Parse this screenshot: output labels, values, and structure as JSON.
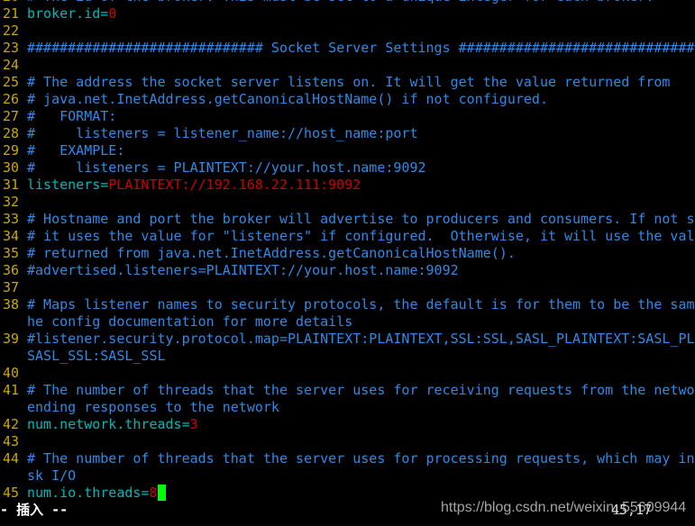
{
  "editor": {
    "rows": [
      {
        "num": "20",
        "segs": [
          {
            "t": "# The id of the broker. This must be set to a unique integer for each broker.",
            "c": "comment"
          }
        ]
      },
      {
        "num": "21",
        "segs": [
          {
            "t": "broker.id=",
            "c": "key"
          },
          {
            "t": "0",
            "c": "val"
          }
        ]
      },
      {
        "num": "22",
        "segs": []
      },
      {
        "num": "23",
        "segs": [
          {
            "t": "############################# Socket Server Settings #############################",
            "c": "comment"
          }
        ]
      },
      {
        "num": "24",
        "segs": []
      },
      {
        "num": "25",
        "segs": [
          {
            "t": "# The address the socket server listens on. It will get the value returned from",
            "c": "comment"
          }
        ]
      },
      {
        "num": "26",
        "segs": [
          {
            "t": "# java.net.InetAddress.getCanonicalHostName() if not configured.",
            "c": "comment"
          }
        ]
      },
      {
        "num": "27",
        "segs": [
          {
            "t": "#   FORMAT:",
            "c": "comment"
          }
        ]
      },
      {
        "num": "28",
        "segs": [
          {
            "t": "#     listeners = listener_name://host_name:port",
            "c": "comment"
          }
        ]
      },
      {
        "num": "29",
        "segs": [
          {
            "t": "#   EXAMPLE:",
            "c": "comment"
          }
        ]
      },
      {
        "num": "30",
        "segs": [
          {
            "t": "#     listeners = PLAINTEXT://your.host.name:9092",
            "c": "comment"
          }
        ]
      },
      {
        "num": "31",
        "segs": [
          {
            "t": "listeners=",
            "c": "key"
          },
          {
            "t": "PLAINTEXT://192.168.22.111:9092",
            "c": "val"
          }
        ]
      },
      {
        "num": "32",
        "segs": []
      },
      {
        "num": "33",
        "segs": [
          {
            "t": "# Hostname and port the broker will advertise to producers and consumers. If not se",
            "c": "comment"
          }
        ]
      },
      {
        "num": "34",
        "segs": [
          {
            "t": "# it uses the value for \"listeners\" if configured.  Otherwise, it will use the valu",
            "c": "comment"
          }
        ]
      },
      {
        "num": "35",
        "segs": [
          {
            "t": "# returned from java.net.InetAddress.getCanonicalHostName().",
            "c": "comment"
          }
        ]
      },
      {
        "num": "36",
        "segs": [
          {
            "t": "#advertised.listeners=PLAINTEXT://your.host.name:9092",
            "c": "comment"
          }
        ]
      },
      {
        "num": "37",
        "segs": []
      },
      {
        "num": "38",
        "segs": [
          {
            "t": "# Maps listener names to security protocols, the default is for them to be the same",
            "c": "comment"
          }
        ]
      },
      {
        "num": "",
        "segs": [
          {
            "t": "he config documentation for more details",
            "c": "comment"
          }
        ]
      },
      {
        "num": "39",
        "segs": [
          {
            "t": "#listener.security.protocol.map=PLAINTEXT:PLAINTEXT,SSL:SSL,SASL_PLAINTEXT:SASL_PLA",
            "c": "comment"
          }
        ]
      },
      {
        "num": "",
        "segs": [
          {
            "t": "SASL_SSL:SASL_SSL",
            "c": "comment"
          }
        ]
      },
      {
        "num": "40",
        "segs": []
      },
      {
        "num": "41",
        "segs": [
          {
            "t": "# The number of threads that the server uses for receiving requests from the networ",
            "c": "comment"
          }
        ]
      },
      {
        "num": "",
        "segs": [
          {
            "t": "ending responses to the network",
            "c": "comment"
          }
        ]
      },
      {
        "num": "42",
        "segs": [
          {
            "t": "num.network.threads=",
            "c": "key"
          },
          {
            "t": "3",
            "c": "val"
          }
        ]
      },
      {
        "num": "43",
        "segs": []
      },
      {
        "num": "44",
        "segs": [
          {
            "t": "# The number of threads that the server uses for processing requests, which may inc",
            "c": "comment"
          }
        ]
      },
      {
        "num": "",
        "segs": [
          {
            "t": "sk I/O",
            "c": "comment"
          }
        ]
      },
      {
        "num": "45",
        "segs": [
          {
            "t": "num.io.threads=",
            "c": "key"
          },
          {
            "t": "8",
            "c": "val"
          }
        ],
        "cursor": true
      }
    ]
  },
  "status": {
    "mode": "-- 插入 --",
    "ruler": "45,17"
  },
  "watermark": "https://blog.csdn.net/weixin_55609944",
  "colors": {
    "background": "#000000",
    "line_number": "#c8a800",
    "comment": "#2e8ae6",
    "key": "#00b8b8",
    "value": "#d00000",
    "cursor": "#00ff00"
  }
}
